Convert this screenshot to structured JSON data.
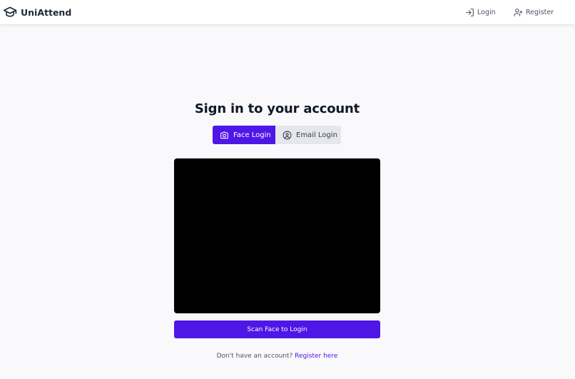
{
  "app": {
    "name": "UniAttend",
    "logo_icon": "graduation-cap-icon"
  },
  "nav": {
    "login_label": "Login",
    "login_icon": "login-arrow-icon",
    "register_label": "Register",
    "register_icon": "user-plus-icon"
  },
  "main": {
    "title": "Sign in to your account",
    "tabs": [
      {
        "label": "Face Login",
        "icon": "camera-icon",
        "active": true
      },
      {
        "label": "Email Login",
        "icon": "user-circle-icon",
        "active": false
      }
    ],
    "scan_button_label": "Scan Face to Login",
    "footer_prompt": "Don't have an account?",
    "footer_link": "Register here"
  },
  "colors": {
    "accent": "#4f16e8",
    "background": "#f9f9fb",
    "navbar": "#ffffff",
    "video": "#000000",
    "inactive_tab": "#e5e7eb"
  }
}
